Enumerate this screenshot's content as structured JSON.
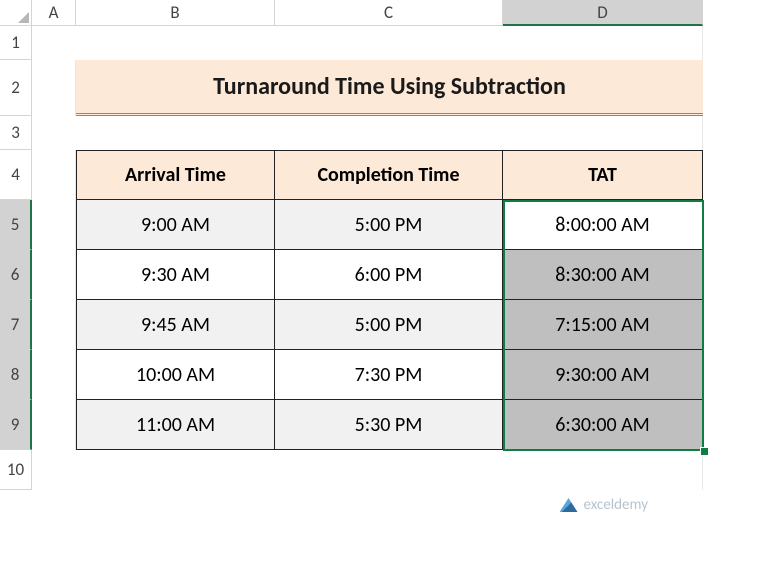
{
  "columns": [
    "A",
    "B",
    "C",
    "D"
  ],
  "rows": [
    "1",
    "2",
    "3",
    "4",
    "5",
    "6",
    "7",
    "8",
    "9",
    "10"
  ],
  "title": "Turnaround Time Using Subtraction",
  "headers": {
    "arrival": "Arrival Time",
    "completion": "Completion Time",
    "tat": "TAT"
  },
  "data_rows": [
    {
      "arrival": "9:00 AM",
      "completion": "5:00 PM",
      "tat": "8:00:00 AM"
    },
    {
      "arrival": "9:30 AM",
      "completion": "6:00 PM",
      "tat": "8:30:00 AM"
    },
    {
      "arrival": "9:45 AM",
      "completion": "5:00 PM",
      "tat": "7:15:00 AM"
    },
    {
      "arrival": "10:00 AM",
      "completion": "7:30 PM",
      "tat": "9:30:00 AM"
    },
    {
      "arrival": "11:00 AM",
      "completion": "5:30 PM",
      "tat": "6:30:00 AM"
    }
  ],
  "watermark": "exceldemy",
  "chart_data": {
    "type": "table",
    "title": "Turnaround Time Using Subtraction",
    "columns": [
      "Arrival Time",
      "Completion Time",
      "TAT"
    ],
    "rows": [
      [
        "9:00 AM",
        "5:00 PM",
        "8:00:00 AM"
      ],
      [
        "9:30 AM",
        "6:00 PM",
        "8:30:00 AM"
      ],
      [
        "9:45 AM",
        "5:00 PM",
        "7:15:00 AM"
      ],
      [
        "10:00 AM",
        "7:30 PM",
        "9:30:00 AM"
      ],
      [
        "11:00 AM",
        "5:30 PM",
        "6:30:00 AM"
      ]
    ]
  }
}
